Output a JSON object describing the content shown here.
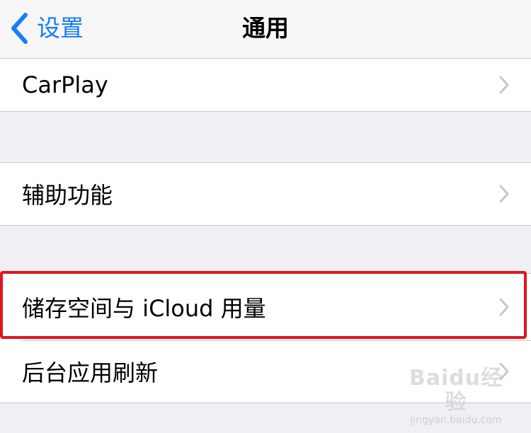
{
  "navbar": {
    "back_label": "设置",
    "title": "通用"
  },
  "rows": {
    "carplay": "CarPlay",
    "accessibility": "辅助功能",
    "storage": "储存空间与 iCloud 用量",
    "background_refresh": "后台应用刷新"
  },
  "watermark": {
    "logo": "Baidu经验",
    "url": "jingyan.baidu.com"
  },
  "icons": {
    "back": "chevron-left-icon",
    "disclosure": "chevron-right-icon"
  },
  "colors": {
    "accent": "#157efb",
    "highlight": "#e0161e",
    "background": "#efeff4",
    "chevron": "#c7c7cc"
  }
}
